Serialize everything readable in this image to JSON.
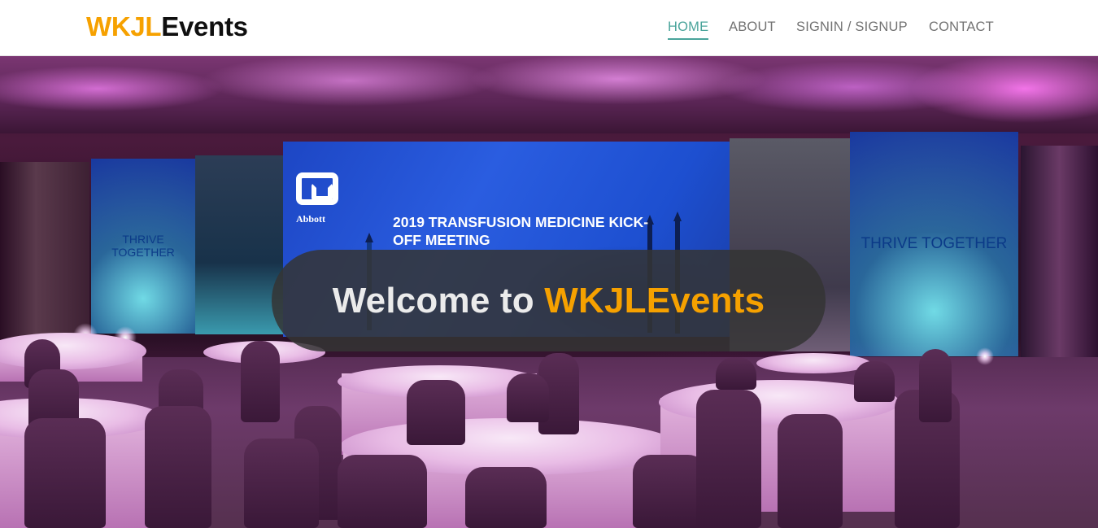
{
  "brand": {
    "part1": "WKJL",
    "part2": "Events",
    "color_accent": "#f6a100",
    "color_dark": "#0f0f0f"
  },
  "nav": {
    "items": [
      {
        "label": "HOME",
        "active": true
      },
      {
        "label": "ABOUT",
        "active": false
      },
      {
        "label": "SIGNIN / SIGNUP",
        "active": false
      },
      {
        "label": "CONTACT",
        "active": false
      }
    ],
    "active_color": "#4aa49b",
    "color": "#727272"
  },
  "hero": {
    "welcome_prefix": "Welcome to",
    "welcome_brand": "WKJLEvents",
    "photo": {
      "screen_left_text": "THRIVE TOGETHER",
      "screen_right_text": "THRIVE TOGETHER",
      "main_screen_logo": "Abbott",
      "main_screen_title": "2019 TRANSFUSION MEDICINE KICK-OFF MEETING"
    }
  }
}
